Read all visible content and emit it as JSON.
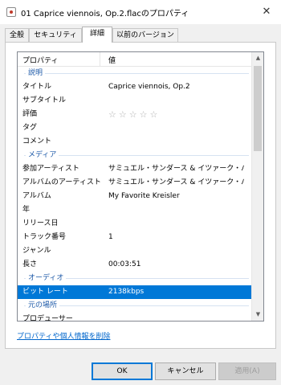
{
  "window": {
    "title": "01 Caprice viennois, Op.2.flacのプロパティ",
    "close_glyph": "✕"
  },
  "tabs": [
    {
      "label": "全般"
    },
    {
      "label": "セキュリティ"
    },
    {
      "label": "詳細"
    },
    {
      "label": "以前のバージョン"
    }
  ],
  "active_tab": "詳細",
  "table": {
    "header": {
      "property": "プロパティ",
      "value": "値"
    },
    "groups": {
      "description": "説明",
      "media": "メディア",
      "audio": "オーディオ",
      "origin": "元の場所"
    },
    "rows": {
      "title": {
        "key": "タイトル",
        "value": "Caprice viennois, Op.2"
      },
      "subtitle": {
        "key": "サブタイトル",
        "value": ""
      },
      "rating": {
        "key": "評価",
        "value": "☆☆☆☆☆"
      },
      "tags": {
        "key": "タグ",
        "value": ""
      },
      "comments": {
        "key": "コメント",
        "value": ""
      },
      "contributing_artists": {
        "key": "参加アーティスト",
        "value": "サミュエル・サンダース & イツァーク・パー..."
      },
      "album_artist": {
        "key": "アルバムのアーティスト",
        "value": "サミュエル・サンダース & イツァーク・パー..."
      },
      "album": {
        "key": "アルバム",
        "value": "My Favorite Kreisler"
      },
      "year": {
        "key": "年",
        "value": ""
      },
      "release_date": {
        "key": "リリース日",
        "value": ""
      },
      "track_number": {
        "key": "トラック番号",
        "value": "1"
      },
      "genre": {
        "key": "ジャンル",
        "value": ""
      },
      "length": {
        "key": "長さ",
        "value": "00:03:51"
      },
      "bit_rate": {
        "key": "ビット レート",
        "value": "2138kbps"
      },
      "producers": {
        "key": "プロデューサー",
        "value": ""
      }
    }
  },
  "remove_link": "プロパティや個人情報を削除",
  "buttons": {
    "ok": "OK",
    "cancel": "キャンセル",
    "apply": "適用(A)"
  }
}
